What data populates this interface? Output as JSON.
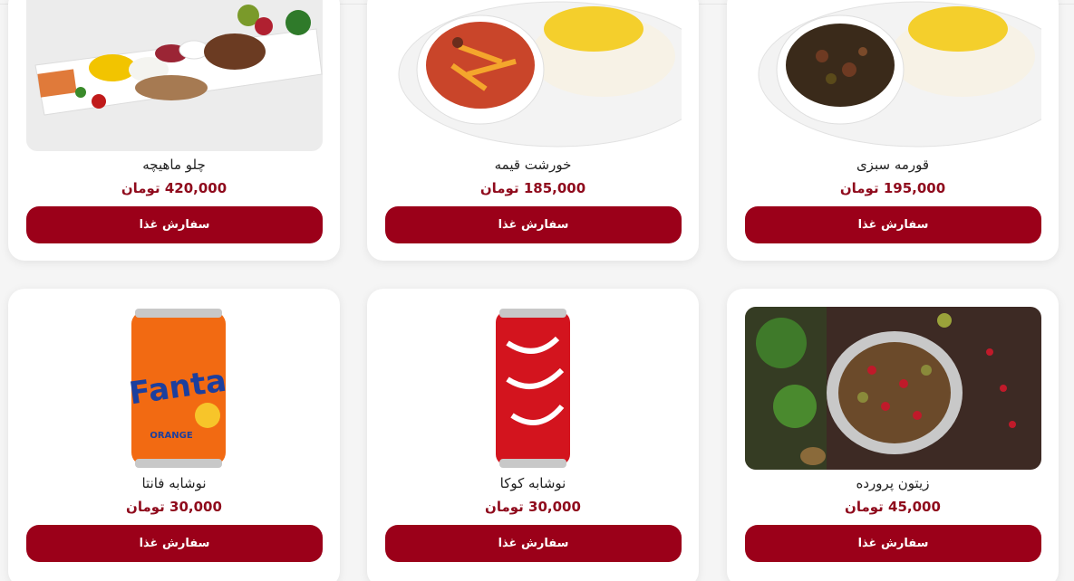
{
  "currency": "تومان",
  "order_label": "سفارش غذا",
  "items": [
    {
      "name": "چلو ماهیچه",
      "price": "420,000"
    },
    {
      "name": "خورشت قیمه",
      "price": "185,000"
    },
    {
      "name": "قورمه سبزی",
      "price": "195,000"
    },
    {
      "name": "نوشابه فانتا",
      "price": "30,000"
    },
    {
      "name": "نوشابه کوکا",
      "price": "30,000"
    },
    {
      "name": "زیتون پرورده",
      "price": "45,000"
    }
  ],
  "colors": {
    "accent": "#9b0019",
    "price": "#8f0a1c",
    "background": "#f5f5f5",
    "card": "#ffffff"
  }
}
